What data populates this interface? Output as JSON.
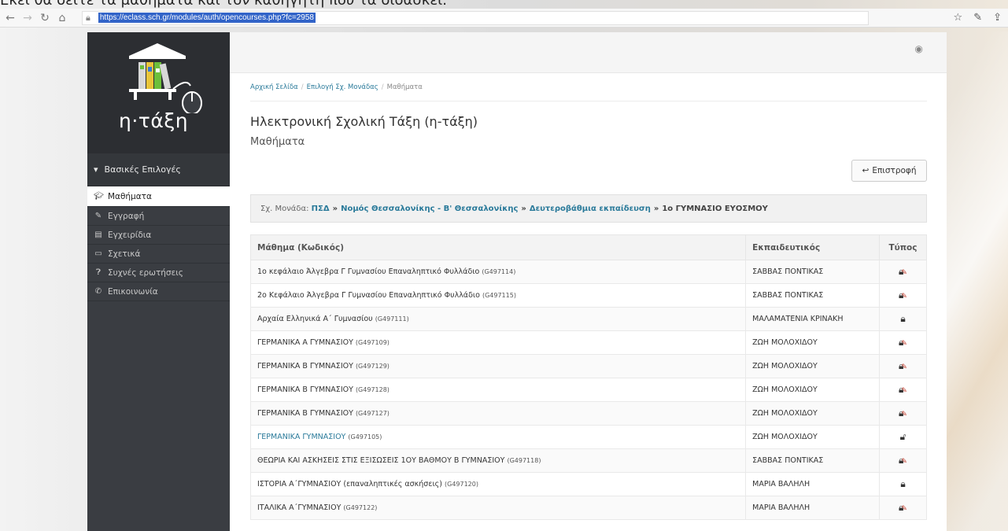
{
  "caption": "Εκεί θα δείτε τα μαθήματα και τον καθηγητή που τα διδάσκει.",
  "browser": {
    "url": "https://eclass.sch.gr/modules/auth/opencourses.php?fc=2958"
  },
  "sidebar": {
    "logo_text": "η·τάξη",
    "section_label": "Βασικές Επιλογές",
    "items": [
      {
        "label": "Μαθήματα",
        "icon": "graduation-cap-icon",
        "active": true
      },
      {
        "label": "Εγγραφή",
        "icon": "edit-icon",
        "active": false
      },
      {
        "label": "Εγχειρίδια",
        "icon": "document-icon",
        "active": false
      },
      {
        "label": "Σχετικά",
        "icon": "card-icon",
        "active": false
      },
      {
        "label": "Συχνές ερωτήσεις",
        "icon": "question-icon",
        "active": false
      },
      {
        "label": "Επικοινωνία",
        "icon": "phone-icon",
        "active": false
      }
    ]
  },
  "breadcrumb": {
    "home": "Αρχική Σελίδα",
    "unit": "Επιλογή Σχ. Μονάδας",
    "current": "Μαθήματα"
  },
  "page": {
    "title": "Ηλεκτρονική Σχολική Τάξη (η-τάξη)",
    "subtitle": "Μαθήματα",
    "back_label": "Επιστροφή"
  },
  "school_unit": {
    "prefix": "Σχ. Μονάδα:",
    "level1": "ΠΣΔ",
    "level2": "Νομός Θεσσαλονίκης - Β' Θεσσαλονίκης",
    "level3": "Δευτεροβάθμια εκπαίδευση",
    "level4": "1ο ΓΥΜΝΑΣΙΟ ΕΥΟΣΜΟΥ"
  },
  "table": {
    "headers": {
      "course": "Μάθημα (Κωδικός)",
      "teacher": "Εκπαιδευτικός",
      "type": "Τύπος"
    },
    "rows": [
      {
        "name": "1ο κεφάλαιο Άλγεβρα Γ Γυμνασίου Επαναληπτικό Φυλλάδιο",
        "code": "(G497114)",
        "teacher": "ΣΑΒΒΑΣ ΠΟΝΤΙΚΑΣ",
        "type": "lock-edit-icon",
        "link": false
      },
      {
        "name": "2ο Κεφάλαιο Άλγεβρα Γ Γυμνασίου Επαναληπτικό Φυλλάδιο",
        "code": "(G497115)",
        "teacher": "ΣΑΒΒΑΣ ΠΟΝΤΙΚΑΣ",
        "type": "lock-edit-icon",
        "link": false
      },
      {
        "name": "Αρχαία Ελληνικά Α΄ Γυμνασίου",
        "code": "(G497111)",
        "teacher": "ΜΑΛΑΜΑΤΕΝΙΑ ΚΡΙΝΑΚΗ",
        "type": "lock-icon",
        "link": false
      },
      {
        "name": "ΓΕΡΜΑΝΙΚΑ Α ΓΥΜΝΑΣΙΟΥ",
        "code": "(G497109)",
        "teacher": "ΖΩΗ ΜΟΛΟΧΙΔΟΥ",
        "type": "lock-edit-icon",
        "link": false
      },
      {
        "name": "ΓΕΡΜΑΝΙΚΑ Β ΓΥΜΝΑΣΙΟΥ",
        "code": "(G497129)",
        "teacher": "ΖΩΗ ΜΟΛΟΧΙΔΟΥ",
        "type": "lock-edit-icon",
        "link": false
      },
      {
        "name": "ΓΕΡΜΑΝΙΚΑ Β ΓΥΜΝΑΣΙΟΥ",
        "code": "(G497128)",
        "teacher": "ΖΩΗ ΜΟΛΟΧΙΔΟΥ",
        "type": "lock-edit-icon",
        "link": false
      },
      {
        "name": "ΓΕΡΜΑΝΙΚΑ Β ΓΥΜΝΑΣΙΟΥ",
        "code": "(G497127)",
        "teacher": "ΖΩΗ ΜΟΛΟΧΙΔΟΥ",
        "type": "lock-edit-icon",
        "link": false
      },
      {
        "name": "ΓΕΡΜΑΝΙΚΑ ΓΥΜΝΑΣΙΟΥ",
        "code": "(G497105)",
        "teacher": "ΖΩΗ ΜΟΛΟΧΙΔΟΥ",
        "type": "unlock-icon",
        "link": true
      },
      {
        "name": "ΘΕΩΡΙΑ ΚΑΙ ΑΣΚΗΣΕΙΣ ΣΤΙΣ ΕΞΙΣΩΣΕΙΣ 1ΟΥ ΒΑΘΜΟΥ Β ΓΥΜΝΑΣΙΟΥ",
        "code": "(G497118)",
        "teacher": "ΣΑΒΒΑΣ ΠΟΝΤΙΚΑΣ",
        "type": "lock-edit-icon",
        "link": false
      },
      {
        "name": "ΙΣΤΟΡΙΑ Α΄ΓΥΜΝΑΣΙΟΥ (επαναληπτικές ασκήσεις)",
        "code": "(G497120)",
        "teacher": "ΜΑΡΙΑ ΒΑΛΗΛΗ",
        "type": "lock-icon",
        "link": false
      },
      {
        "name": "ΙΤΑΛΙΚΑ Α΄ΓΥΜΝΑΣΙΟΥ",
        "code": "(G497122)",
        "teacher": "ΜΑΡΙΑ ΒΑΛΗΛΗ",
        "type": "lock-edit-icon",
        "link": false
      }
    ]
  }
}
